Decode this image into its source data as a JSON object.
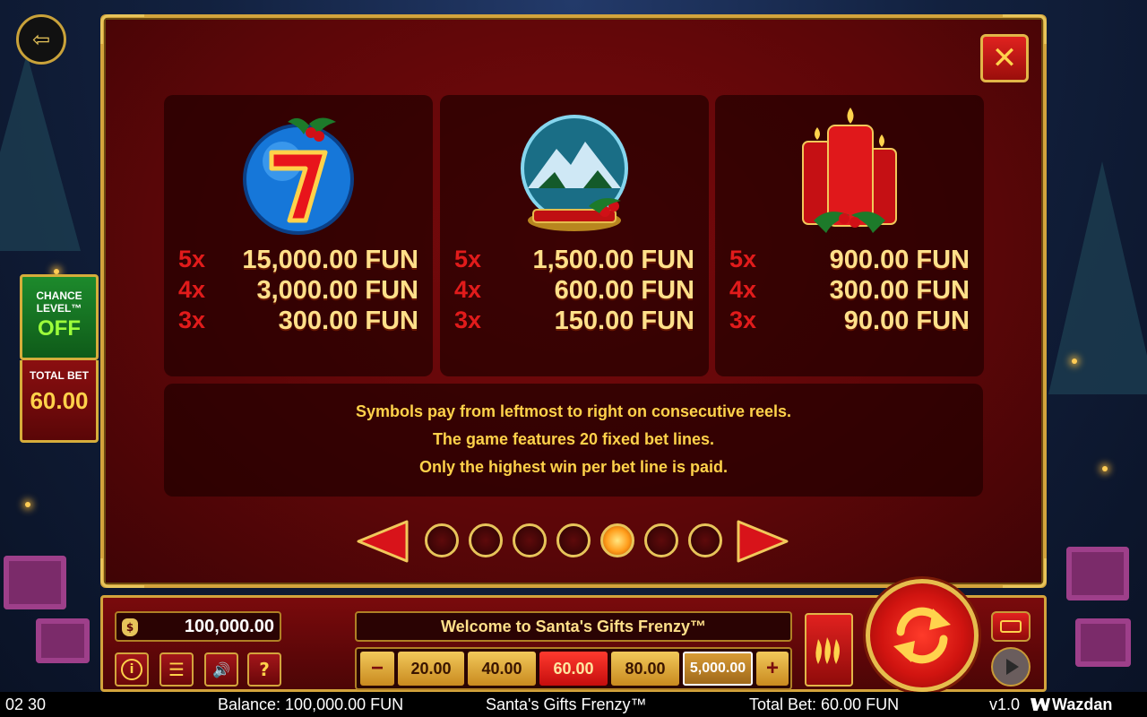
{
  "paytable": {
    "symbols": [
      {
        "icon": "lucky-seven-icon",
        "payouts": [
          {
            "mult": "5x",
            "value": "15,000.00 FUN"
          },
          {
            "mult": "4x",
            "value": "3,000.00 FUN"
          },
          {
            "mult": "3x",
            "value": "300.00 FUN"
          }
        ]
      },
      {
        "icon": "snow-globe-icon",
        "payouts": [
          {
            "mult": "5x",
            "value": "1,500.00 FUN"
          },
          {
            "mult": "4x",
            "value": "600.00 FUN"
          },
          {
            "mult": "3x",
            "value": "150.00 FUN"
          }
        ]
      },
      {
        "icon": "candles-icon",
        "payouts": [
          {
            "mult": "5x",
            "value": "900.00 FUN"
          },
          {
            "mult": "4x",
            "value": "300.00 FUN"
          },
          {
            "mult": "3x",
            "value": "90.00 FUN"
          }
        ]
      }
    ],
    "info_lines": [
      "Symbols pay from leftmost to right on consecutive reels.",
      "The game features 20 fixed bet lines.",
      "Only the highest win per bet line is paid."
    ],
    "page_count": 7,
    "active_page": 5
  },
  "left_panel": {
    "chance_label": "CHANCE LEVEL™",
    "chance_value": "OFF",
    "total_bet_label": "TOTAL BET",
    "total_bet_value": "60.00"
  },
  "controls": {
    "balance": "100,000.00",
    "message": "Welcome to Santa's Gifts Frenzy™",
    "bets": [
      "20.00",
      "40.00",
      "60.00",
      "80.00",
      "5,000.00"
    ],
    "selected_bet": "60.00",
    "minus": "−",
    "plus": "+",
    "info_glyph": "i",
    "menu_glyph": "☰",
    "sound_glyph": "🔊",
    "help_glyph": "?"
  },
  "status_bar": {
    "time": "02 30",
    "balance": "Balance: 100,000.00 FUN",
    "title": "Santa's Gifts Frenzy™",
    "total_bet": "Total Bet: 60.00 FUN",
    "version": "v1.0",
    "brand": "Wazdan"
  },
  "colors": {
    "accent_gold": "#d3a43c",
    "panel_red": "#5b0608",
    "text_yellow": "#ffd24a",
    "mult_red": "#e11b1b"
  }
}
